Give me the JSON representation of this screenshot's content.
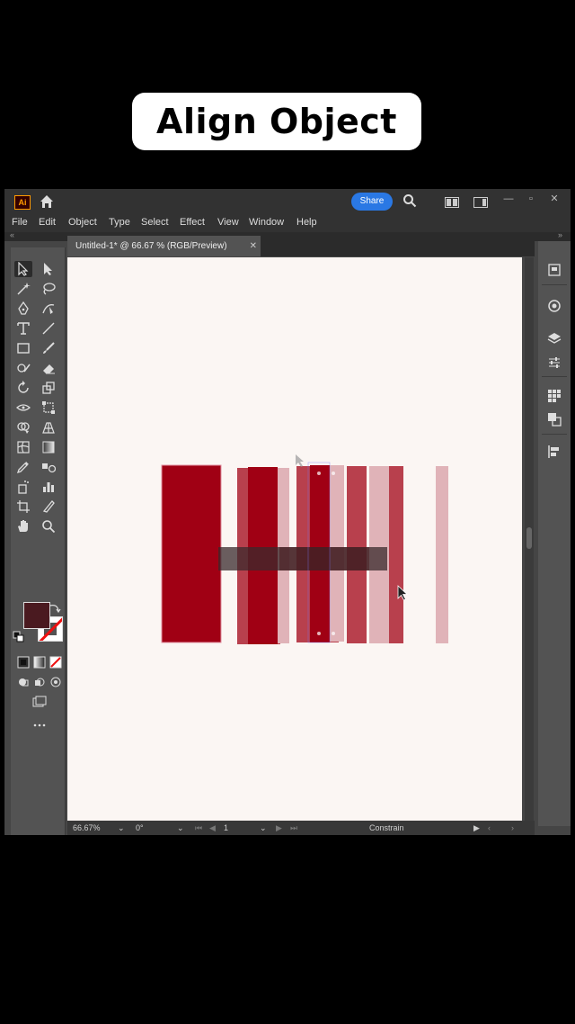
{
  "overlay_title": "Align Object",
  "app": {
    "logo_text": "Ai",
    "share_label": "Share",
    "menu": [
      "File",
      "Edit",
      "Object",
      "Type",
      "Select",
      "Effect",
      "View",
      "Window",
      "Help"
    ],
    "doc_tab": "Untitled-1* @ 66.67 % (RGB/Preview)",
    "doc_tab_close": "✕",
    "status": {
      "zoom": "66.67%",
      "rotation": "0°",
      "artboard": "1",
      "constrain": "Constrain"
    },
    "colors": {
      "fill_swatch": "#4a1a20",
      "accent": "#2a78e4",
      "bar_dark": "#a00014",
      "bar_mid": "#b8404d",
      "bar_light": "#e0b3b8"
    }
  }
}
